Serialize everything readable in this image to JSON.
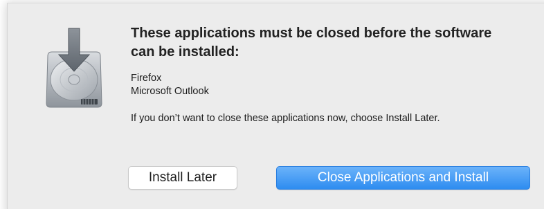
{
  "dialog": {
    "icon": "installer-disk-icon",
    "title": "These applications must be closed before the software can be installed:",
    "applications": [
      "Firefox",
      "Microsoft Outlook"
    ],
    "message": "If you don’t want to close these applications now, choose Install Later."
  },
  "buttons": {
    "install_later_label": "Install Later",
    "close_and_install_label": "Close Applications and Install"
  },
  "colors": {
    "dialog_background": "#ececec",
    "primary_button": "#3a93f2",
    "primary_button_text": "#ffffff",
    "secondary_button": "#ffffff"
  }
}
